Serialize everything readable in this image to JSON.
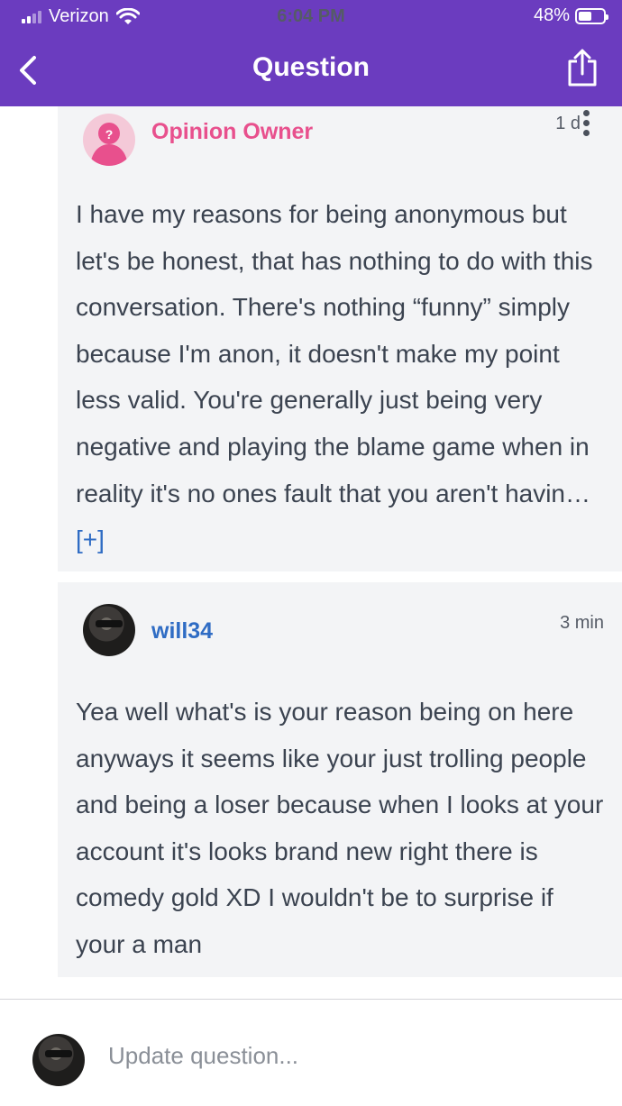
{
  "status_bar": {
    "carrier": "Verizon",
    "time": "6:04 PM",
    "battery": "48%"
  },
  "nav": {
    "title": "Question"
  },
  "replies": [
    {
      "author": "Opinion Owner",
      "time": "1 d",
      "text": "I have my reasons for being anonymous but let's be honest, that has nothing to do with this conversation. There's nothing “funny” simply because I'm anon, it doesn't make my point less valid. You're generally just being very negative and playing the blame game when in reality it's no ones fault that you aren't havin…",
      "more_label": "[+]"
    },
    {
      "author": "will34",
      "time": "3 min",
      "text": "Yea well what's is your reason being on here anyways it seems like your just trolling people and being a loser because when I looks at your account it's looks brand new right there is comedy gold XD I wouldn't be to surprise if your a man"
    }
  ],
  "composer": {
    "placeholder": "Update question..."
  },
  "colors": {
    "header": "#6b3cbf",
    "owner_name": "#e8508d",
    "user_name": "#2f6cc4",
    "card_bg": "#f3f4f6"
  },
  "icons": [
    "signal-icon",
    "wifi-icon",
    "battery-icon",
    "back-icon",
    "share-icon",
    "more-options-icon"
  ]
}
